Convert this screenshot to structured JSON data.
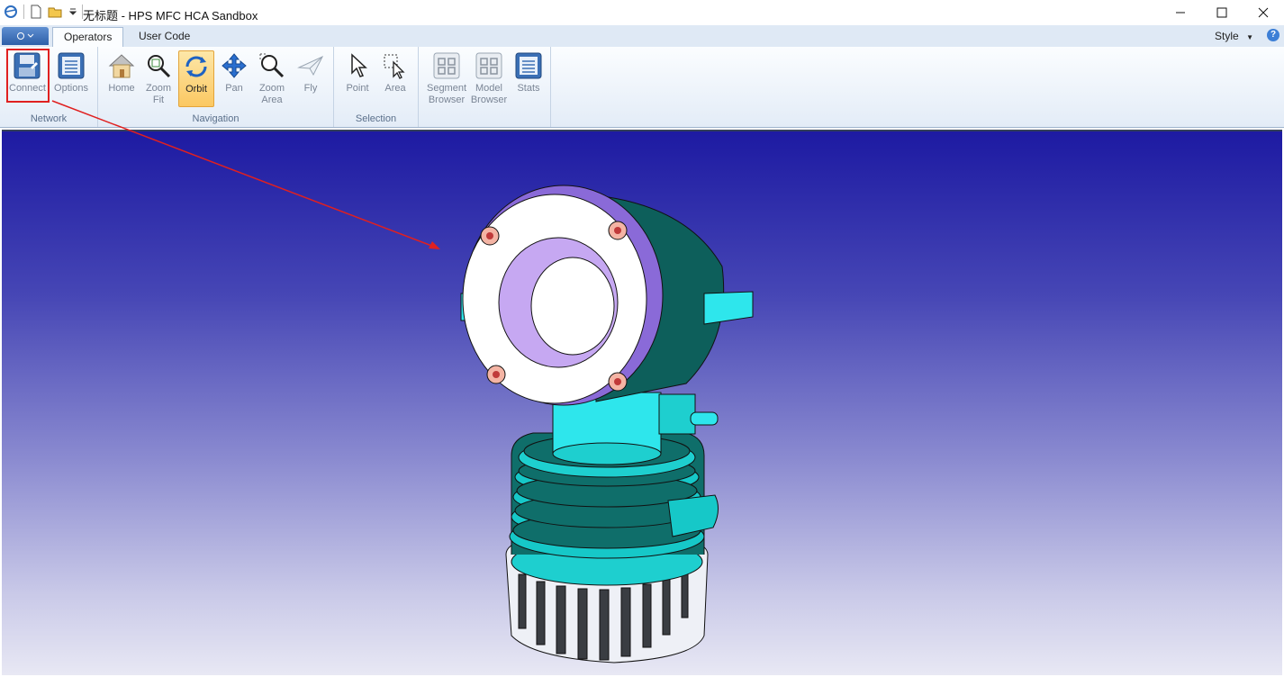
{
  "window": {
    "title": "无标题 - HPS MFC HCA Sandbox"
  },
  "tabs": [
    {
      "label": "Operators",
      "active": true
    },
    {
      "label": "User Code",
      "active": false
    }
  ],
  "style_menu": "Style",
  "help_glyph": "?",
  "ribbon": {
    "groups": {
      "network": "Network",
      "navigation": "Navigation",
      "selection": "Selection"
    },
    "buttons": {
      "connect": "Connect",
      "options": "Options",
      "home": "Home",
      "zoom_fit_1": "Zoom",
      "zoom_fit_2": "Fit",
      "orbit": "Orbit",
      "pan": "Pan",
      "zoom_area_1": "Zoom",
      "zoom_area_2": "Area",
      "fly": "Fly",
      "point": "Point",
      "area": "Area",
      "segment_browser_1": "Segment",
      "segment_browser_2": "Browser",
      "model_browser_1": "Model",
      "model_browser_2": "Browser",
      "stats": "Stats"
    }
  },
  "colors": {
    "accent": "#2d5fa8",
    "active_button": "#fbc862",
    "annotation": "#e02020",
    "viewport_top": "#1d1aa2",
    "viewport_bottom": "#e8e8f4"
  }
}
